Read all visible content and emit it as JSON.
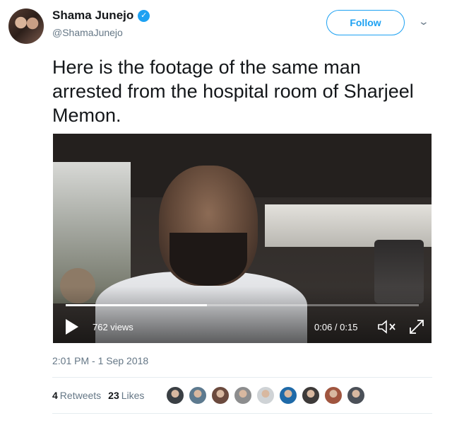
{
  "author": {
    "name": "Shama Junejo",
    "handle": "@ShamaJunejo",
    "verified_icon": "✓",
    "avatar_icon": "user-avatar"
  },
  "follow_label": "Follow",
  "caret_icon": "chevron-down-icon",
  "tweet_text": "Here is the footage of the same man arrested from the hospital room of Sharjeel Memon.",
  "video": {
    "views": "762 views",
    "time": "0:06 / 0:15",
    "progress_fraction": 0.4,
    "play_icon": "play-icon",
    "mute_icon": "volume-muted-icon",
    "expand_icon": "expand-icon"
  },
  "timestamp": "2:01 PM - 1 Sep 2018",
  "stats": {
    "retweets_count": "4",
    "retweets_label": "Retweets",
    "likes_count": "23",
    "likes_label": "Likes"
  },
  "likers": [
    {
      "color": "#3a3f44"
    },
    {
      "color": "#5d7a8f"
    },
    {
      "color": "#6b4a3e"
    },
    {
      "color": "#8c8d8e"
    },
    {
      "color": "#cfd3d6"
    },
    {
      "color": "#1f6aa8"
    },
    {
      "color": "#3d3a39"
    },
    {
      "color": "#a0553f"
    },
    {
      "color": "#4b5058"
    }
  ],
  "colors": {
    "accent": "#1da1f2",
    "muted_text": "#657786",
    "text": "#14171a"
  }
}
